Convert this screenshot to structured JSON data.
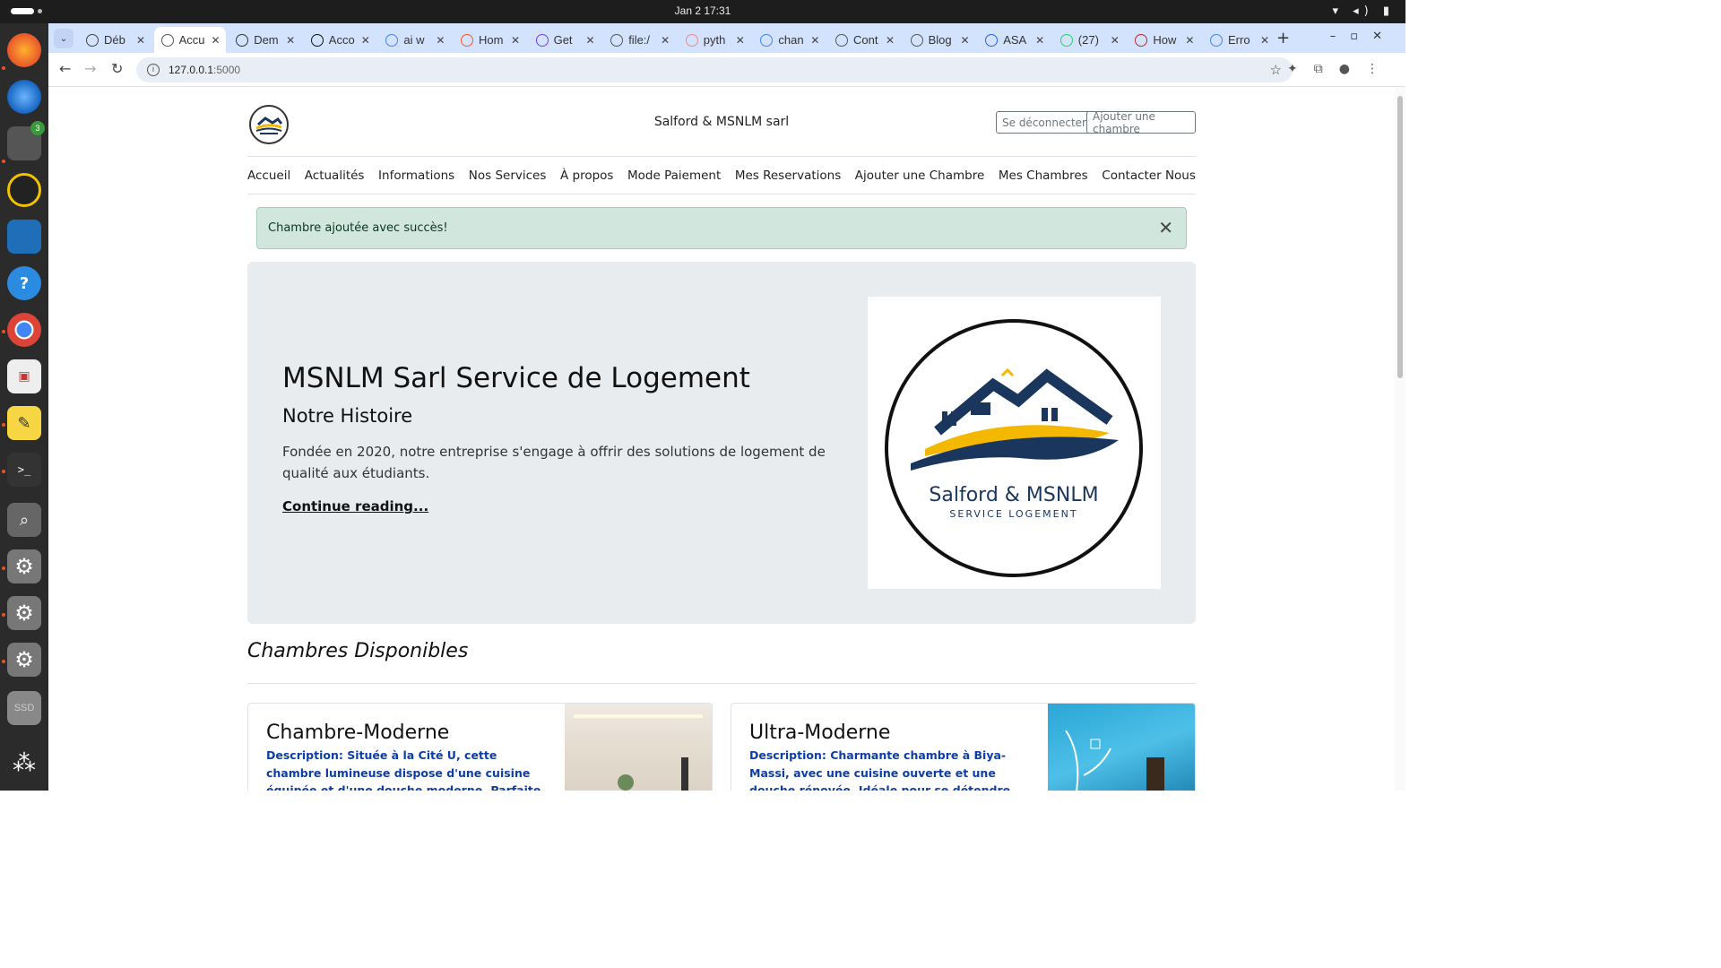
{
  "system": {
    "clock": "Jan 2  17:31"
  },
  "browser": {
    "tabs": [
      {
        "title": "Déb",
        "fav": "#444"
      },
      {
        "title": "Accu",
        "fav": "#555",
        "active": true
      },
      {
        "title": "Dem",
        "fav": "#333"
      },
      {
        "title": "Acco",
        "fav": "#111"
      },
      {
        "title": "ai w",
        "fav": "#4285f4"
      },
      {
        "title": "Hom",
        "fav": "#ff5722"
      },
      {
        "title": "Get",
        "fav": "#7c3aed"
      },
      {
        "title": "file:/",
        "fav": "#555"
      },
      {
        "title": "pyth",
        "fav": "#e88"
      },
      {
        "title": "chan",
        "fav": "#4285f4"
      },
      {
        "title": "Cont",
        "fav": "#555"
      },
      {
        "title": "Blog",
        "fav": "#555"
      },
      {
        "title": "ASA",
        "fav": "#2563eb"
      },
      {
        "title": "(27)",
        "fav": "#25d366"
      },
      {
        "title": "How",
        "fav": "#b92b27"
      },
      {
        "title": "Erro",
        "fav": "#4285f4"
      }
    ],
    "url_host": "127.0.0.1",
    "url_port": ":5000"
  },
  "site": {
    "title": "Salford & MSNLM sarl",
    "buttons": {
      "logout": "Se déconnecter",
      "add_room": "Ajouter une chambre"
    },
    "nav": [
      "Accueil",
      "Actualités",
      "Informations",
      "Nos Services",
      "À propos",
      "Mode Paiement",
      "Mes Reservations",
      "Ajouter une Chambre",
      "Mes Chambres",
      "Contacter Nous"
    ],
    "alert": "Chambre ajoutée avec succès!",
    "hero": {
      "title": "MSNLM Sarl Service de Logement",
      "subtitle": "Notre Histoire",
      "text": "Fondée en 2020, notre entreprise s'engage à offrir des solutions de logement de qualité aux étudiants.",
      "link": "Continue reading...",
      "logo_name": "Salford & MSNLM",
      "logo_tagline": "SERVICE LOGEMENT"
    },
    "rooms_title": "Chambres Disponibles",
    "rooms": [
      {
        "name": "Chambre-Moderne",
        "desc": "Description: Située à la Cité U, cette chambre lumineuse dispose d'une cuisine équipée et d'une douche moderne. Parfaite pour les étudiants, le"
      },
      {
        "name": "Ultra-Moderne",
        "desc": "Description: Charmante chambre à Biya-Massi, avec une cuisine ouverte et une douche rénovée. Idéale pour se détendre après les cours, le quartier"
      }
    ]
  },
  "colors": {
    "navy": "#1b365d",
    "gold": "#f5b800",
    "alert_bg": "#d1e7dd"
  }
}
